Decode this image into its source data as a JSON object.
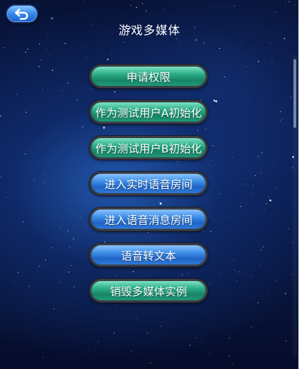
{
  "header": {
    "title": "游戏多媒体",
    "back_icon": "back-arrow-icon"
  },
  "menu": {
    "items": [
      {
        "label": "申请权限",
        "color": "green"
      },
      {
        "label": "作为测试用户A初始化",
        "color": "green"
      },
      {
        "label": "作为测试用户B初始化",
        "color": "green"
      },
      {
        "label": "进入实时语音房间",
        "color": "blue"
      },
      {
        "label": "进入语音消息房间",
        "color": "blue"
      },
      {
        "label": "语音转文本",
        "color": "blue"
      },
      {
        "label": "销毁多媒体实例",
        "color": "green"
      }
    ]
  },
  "colors": {
    "green_button": "#2cae88",
    "blue_button": "#3d8fe8",
    "background": "#0a1b4e"
  }
}
